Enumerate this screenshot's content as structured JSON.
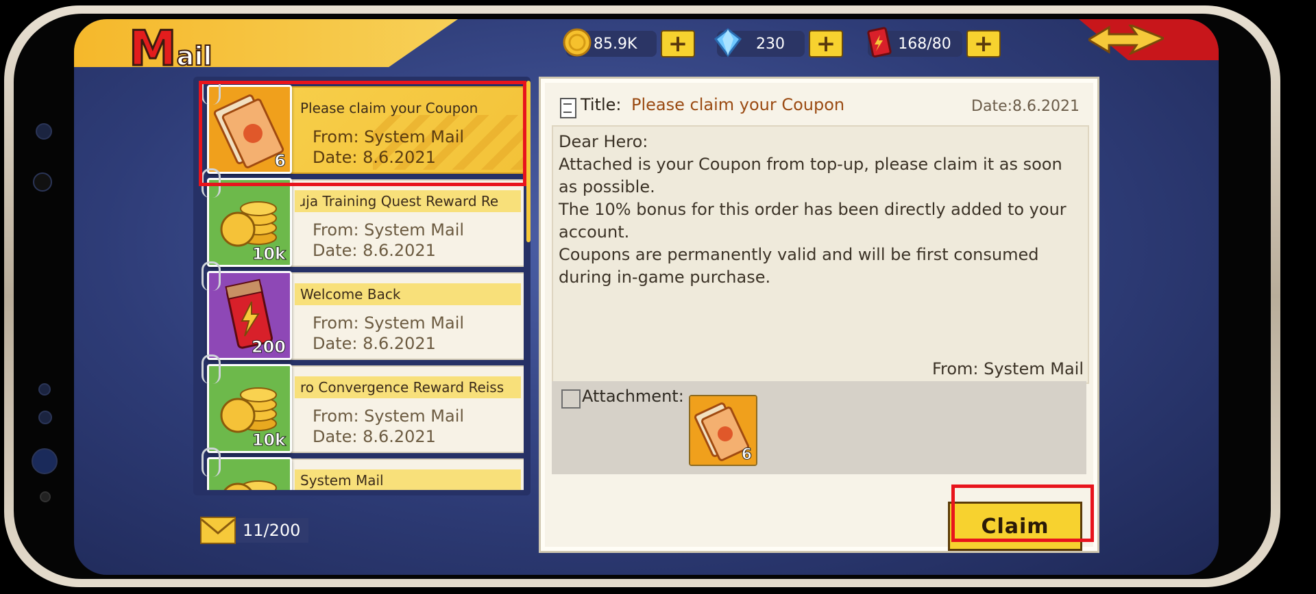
{
  "header": {
    "logo_initial": "M",
    "logo_rest": "ail"
  },
  "currencies": [
    {
      "icon": "gold-coin-icon",
      "value": "85.9K"
    },
    {
      "icon": "diamond-icon",
      "value": "230"
    },
    {
      "icon": "stamina-ticket-icon",
      "value": "168/80"
    }
  ],
  "mail_list": [
    {
      "title": "Please claim your Coupon",
      "from": "From: System Mail",
      "date": "Date: 8.6.2021",
      "count": "6",
      "icon": "coupon-icon",
      "selected": true
    },
    {
      "title": "ɹja Training Quest Reward Re",
      "from": "From: System Mail",
      "date": "Date: 8.6.2021",
      "count": "10k",
      "icon": "gold-coins-icon"
    },
    {
      "title": "Welcome Back",
      "from": "From: System Mail",
      "date": "Date: 8.6.2021",
      "count": "200",
      "icon": "energy-pack-icon"
    },
    {
      "title": "ro Convergence Reward Reiss",
      "from": "From: System Mail",
      "date": "Date: 8.6.2021",
      "count": "10k",
      "icon": "gold-coins-icon"
    },
    {
      "title": "System Mail",
      "from": "",
      "date": "",
      "count": "",
      "icon": "gold-coins-icon"
    }
  ],
  "mail_counter": "11/200",
  "detail": {
    "title_label": "Title:",
    "title": "Please claim your Coupon",
    "date": "Date:8.6.2021",
    "body": "Dear Hero:\nAttached is your Coupon from top-up, please claim it as soon as possible.\nThe 10% bonus for this order has been directly added to your account.\nCoupons are permanently valid and will be first consumed during in-game purchase.",
    "from": "From: System Mail",
    "attachment_label": "Attachment:",
    "attachment_count": "6",
    "claim_label": "Claim"
  },
  "colors": {
    "highlight": "#e8141c",
    "accent_yellow": "#f7d22f",
    "title_brown": "#9a4a12"
  }
}
